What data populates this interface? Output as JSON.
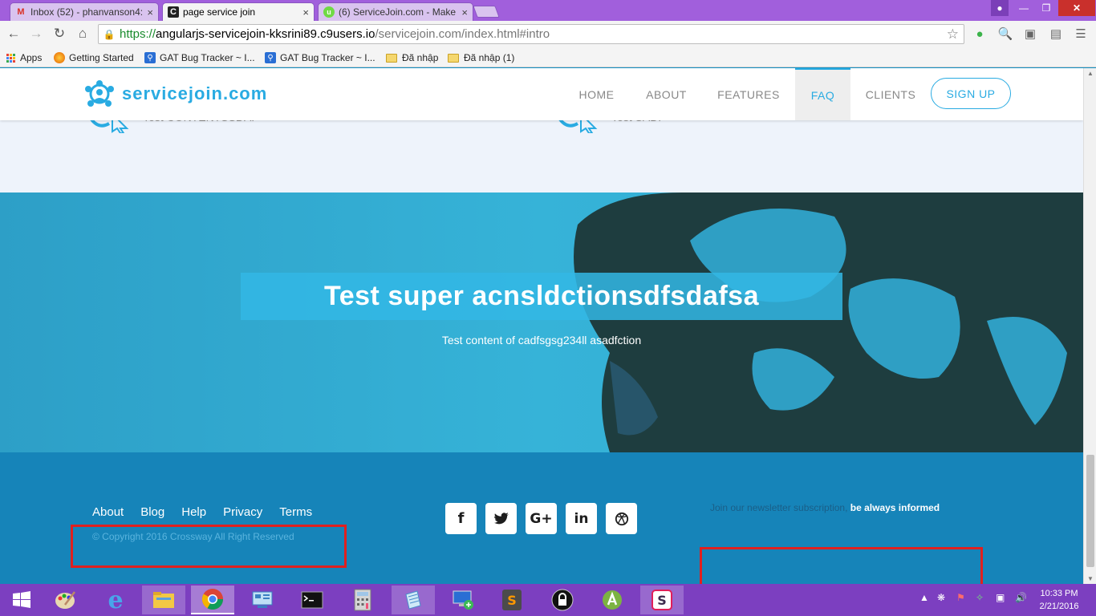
{
  "browser": {
    "tabs": [
      {
        "title": "Inbox (52) - phanvanson4:",
        "icon": "gmail-icon",
        "active": false
      },
      {
        "title": "page service join",
        "icon": "c9-icon",
        "active": true
      },
      {
        "title": "(6) ServiceJoin.com - Make",
        "icon": "upwork-icon",
        "active": false
      }
    ],
    "url": {
      "protocol": "https://",
      "host": "angularjs-servicejoin-kksrini89.c9users.io",
      "path": "/servicejoin.com/index.html#intro"
    },
    "bookmarks": [
      {
        "label": "Apps",
        "icon": "apps-grid-icon"
      },
      {
        "label": "Getting Started",
        "icon": "firefox-icon"
      },
      {
        "label": "GAT Bug Tracker ~ I...",
        "icon": "bug-tracker-icon"
      },
      {
        "label": "GAT Bug Tracker ~ I...",
        "icon": "bug-tracker-icon"
      },
      {
        "label": "Đã nhập",
        "icon": "folder-icon"
      },
      {
        "label": "Đã nhập (1)",
        "icon": "folder-icon"
      }
    ]
  },
  "site": {
    "logo_text": "servicejoin.com",
    "nav": [
      "HOME",
      "ABOUT",
      "FEATURES",
      "FAQ",
      "CLIENTS"
    ],
    "nav_active": "FAQ",
    "signup_label": "SIGN UP",
    "features": [
      {
        "text": "Test CONTENTSSDAF"
      },
      {
        "text": "Test SADF"
      }
    ],
    "hero": {
      "title": "Test super acnsldctionsdfsdafsa",
      "subtitle": "Test content of cadfsgsg234ll asadfction"
    },
    "footer": {
      "links": [
        "About",
        "Blog",
        "Help",
        "Privacy",
        "Terms"
      ],
      "copyright": "© Copyright 2016 Crossway All Right Reserved",
      "social": [
        {
          "name": "facebook-icon",
          "glyph": "f"
        },
        {
          "name": "twitter-icon",
          "glyph": "🐦"
        },
        {
          "name": "google-plus-icon",
          "glyph": "G+"
        },
        {
          "name": "linkedin-icon",
          "glyph": "in"
        },
        {
          "name": "dribbble-icon",
          "glyph": "⚽"
        }
      ],
      "newsletter_text": "Join our newsletter subscription,",
      "newsletter_emphasis": "be always informed"
    }
  },
  "taskbar": {
    "clock_time": "10:33 PM",
    "clock_date": "2/21/2016"
  },
  "colors": {
    "accent": "#29abe2",
    "footer_bg": "#1684b9",
    "hero_bg": "#31acd2",
    "annotation_red": "#e0201f",
    "taskbar_bg": "#7c3fc0"
  }
}
